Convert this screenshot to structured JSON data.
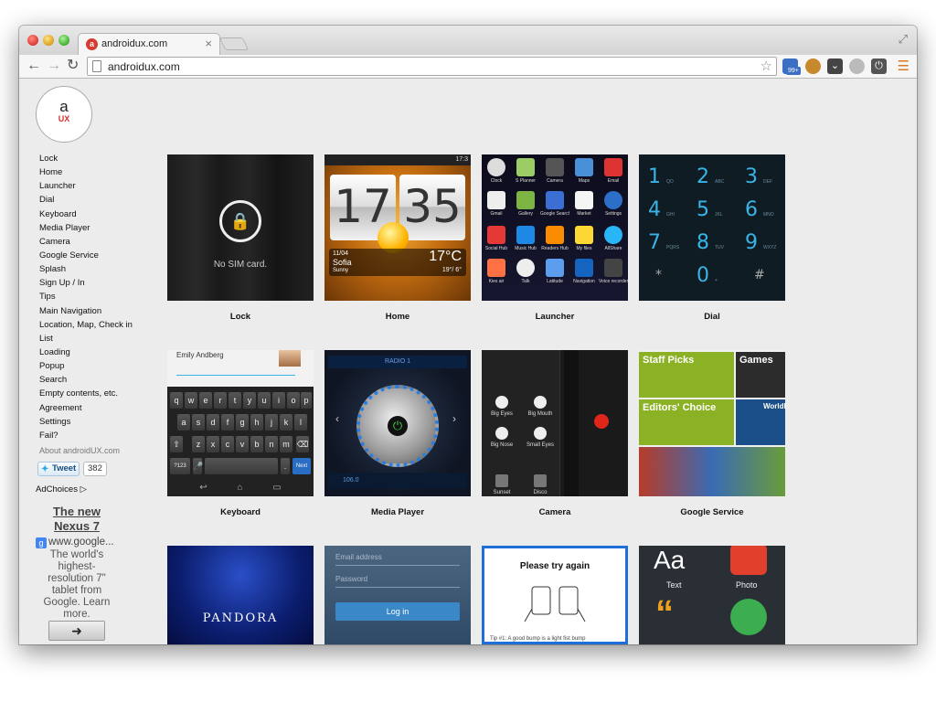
{
  "browser": {
    "tab_title": "androidux.com",
    "tab_favicon": "a",
    "url": "androidux.com",
    "ext_badge": "99+"
  },
  "logo": {
    "a": "a",
    "ux": "UX"
  },
  "sidenav": {
    "items": [
      "Lock",
      "Home",
      "Launcher",
      "Dial",
      "Keyboard",
      "Media Player",
      "Camera",
      "Google Service",
      "Splash",
      "Sign Up / In",
      "Tips",
      "Main Navigation",
      "Location, Map, Check in",
      "List",
      "Loading",
      "Popup",
      "Search",
      "Empty contents, etc.",
      "Agreement",
      "Settings",
      "Fail?"
    ],
    "about": "About androidUX.com"
  },
  "tweet": {
    "label": "Tweet",
    "count": "382"
  },
  "adchoices": "AdChoices",
  "ad": {
    "title": "The new Nexus 7",
    "url": "www.google...",
    "desc": "The world's highest-resolution 7\" tablet from Google. Learn more."
  },
  "grid": {
    "labels": [
      "Lock",
      "Home",
      "Launcher",
      "Dial",
      "Keyboard",
      "Media Player",
      "Camera",
      "Google Service"
    ]
  },
  "shots": {
    "lock": {
      "text": "No SIM card."
    },
    "home": {
      "status": "17:3",
      "hour": "17",
      "minute": "35",
      "date": "11/04",
      "city": "Sofia",
      "cond": "Sunny",
      "temp": "17°C",
      "range": "19°/ 6°"
    },
    "launcher": {
      "apps": [
        "Clock",
        "S Planner",
        "Camera",
        "Maps",
        "Email",
        "Gmail",
        "Gallery",
        "Google Search",
        "Market",
        "Settings",
        "Social Hub",
        "Music Hub",
        "Readers Hub",
        "My files",
        "AllShare",
        "Kies air",
        "Talk",
        "Latitude",
        "Navigation",
        "Voice recorder"
      ]
    },
    "dial": {
      "keys": [
        {
          "n": "1",
          "s": "QO"
        },
        {
          "n": "2",
          "s": "ABC"
        },
        {
          "n": "3",
          "s": "DEF"
        },
        {
          "n": "4",
          "s": "GHI"
        },
        {
          "n": "5",
          "s": "JKL"
        },
        {
          "n": "6",
          "s": "MNO"
        },
        {
          "n": "7",
          "s": "PQRS"
        },
        {
          "n": "8",
          "s": "TUV"
        },
        {
          "n": "9",
          "s": "WXYZ"
        },
        {
          "n": "*",
          "s": ""
        },
        {
          "n": "0",
          "s": "+"
        },
        {
          "n": "#",
          "s": ""
        }
      ]
    },
    "keyboard": {
      "name": "Emily Andberg",
      "row1": [
        "q",
        "w",
        "e",
        "r",
        "t",
        "y",
        "u",
        "i",
        "o",
        "p"
      ],
      "row2": [
        "a",
        "s",
        "d",
        "f",
        "g",
        "h",
        "j",
        "k",
        "l"
      ],
      "row3": [
        "z",
        "x",
        "c",
        "v",
        "b",
        "n",
        "m"
      ],
      "symbols": "?123",
      "next": "Next"
    },
    "media": {
      "station": "RADIO 1",
      "freq": "106.0"
    },
    "camera": {
      "options": [
        "Big Eyes",
        "Big Mouth",
        "Big Nose",
        "Small Eyes",
        "Sunset",
        "Disco"
      ]
    },
    "google_service": {
      "staff": "Staff Picks",
      "games": "Games",
      "editors": "Editors' Choice",
      "world": "WorldM"
    },
    "pandora": {
      "text": "PANDORA"
    },
    "login": {
      "email": "Email address",
      "password": "Password",
      "button": "Log in"
    },
    "try_again": {
      "title": "Please try again",
      "tip": "Tip #1: A good bump is a light fist bump"
    },
    "icons": {
      "aa": "Aa",
      "text": "Text",
      "photo": "Photo"
    }
  }
}
